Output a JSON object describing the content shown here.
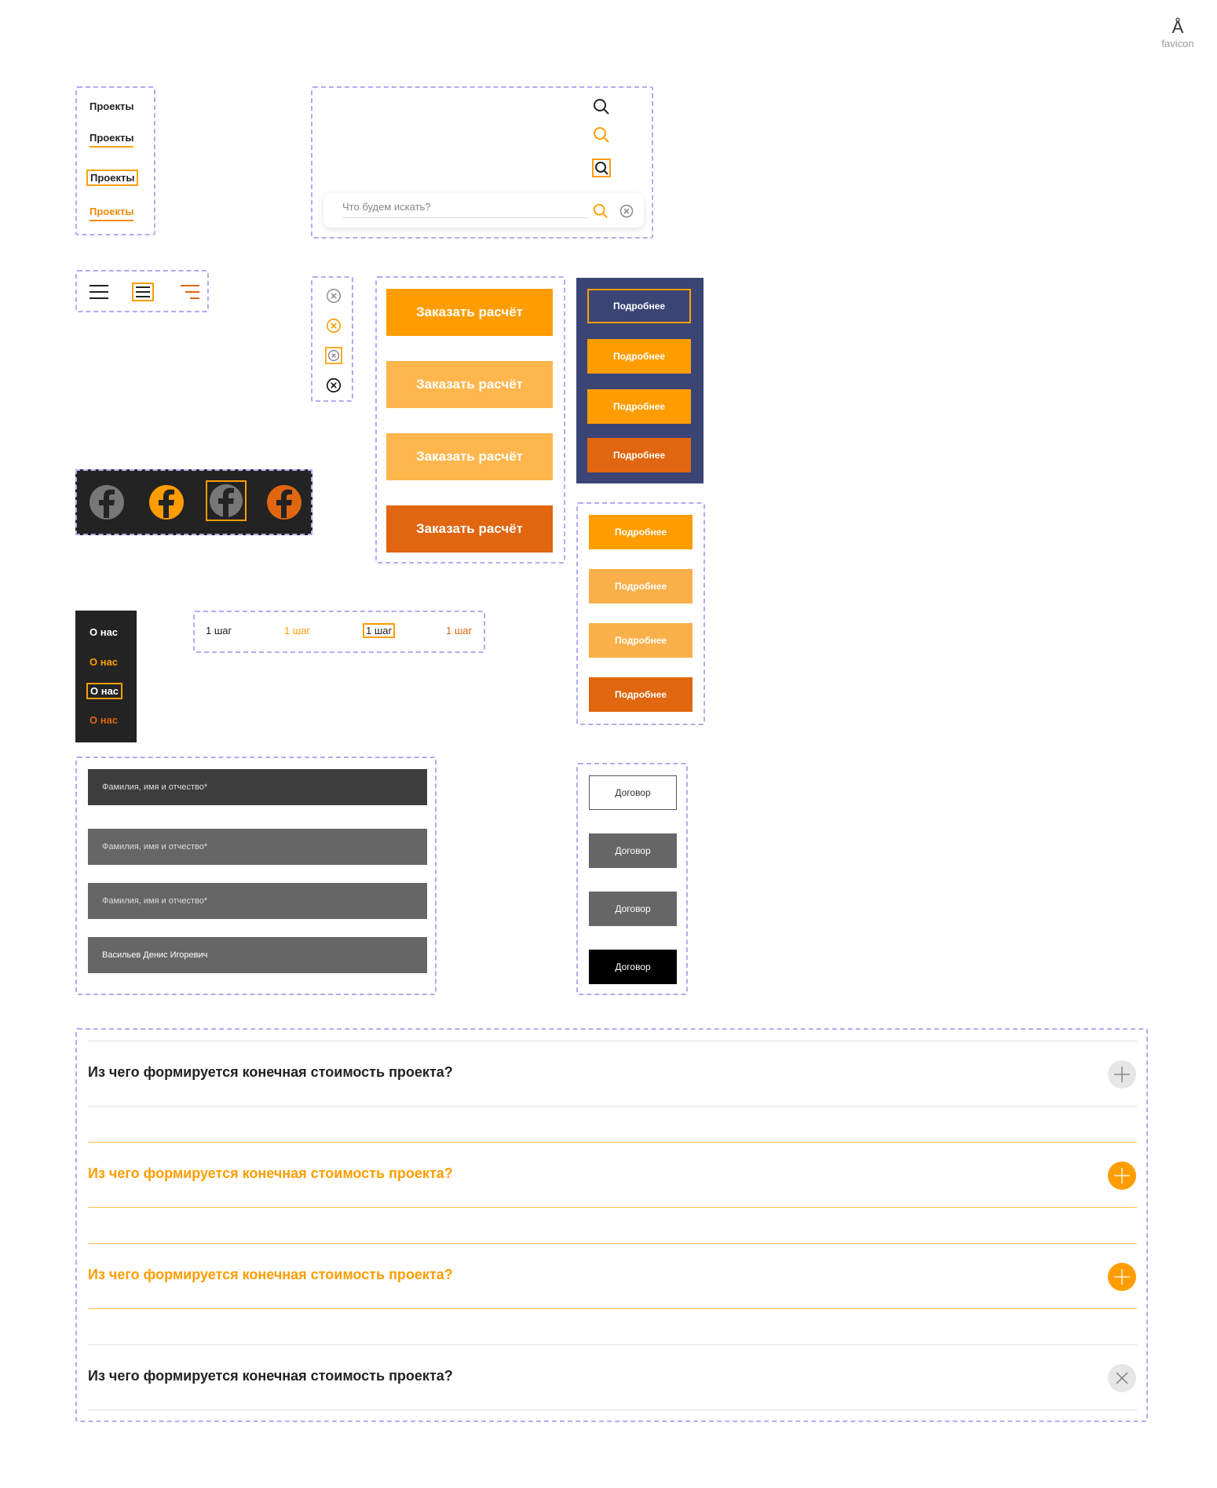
{
  "favicon": {
    "glyph": "Å",
    "label": "favicon"
  },
  "nav": {
    "items": [
      "Проекты",
      "Проекты",
      "Проекты",
      "Проекты"
    ]
  },
  "search": {
    "placeholder": "Что будем искать?"
  },
  "order_buttons": [
    "Заказать расчёт",
    "Заказать расчёт",
    "Заказать расчёт",
    "Заказать расчёт"
  ],
  "details_buttons_dark": [
    "Подробнее",
    "Подробнее",
    "Подробнее",
    "Подробнее"
  ],
  "details_buttons_light": [
    "Подробнее",
    "Подробнее",
    "Подробнее",
    "Подробнее"
  ],
  "about": [
    "О нас",
    "О нас",
    "О нас",
    "О нас"
  ],
  "steps": [
    "1 шаг",
    "1 шаг",
    "1 шаг",
    "1 шаг"
  ],
  "inputs": [
    "Фамилия, имя и отчество*",
    "Фамилия, имя и отчество*",
    "Фамилия, имя и отчество*",
    "Васильев Денис Игоревич"
  ],
  "contracts": [
    "Договор",
    "Договор",
    "Договор",
    "Договор"
  ],
  "faq": [
    "Из чего формируется конечная стоимость проекта?",
    "Из чего формируется конечная стоимость проекта?",
    "Из чего формируется конечная стоимость проекта?",
    "Из чего формируется конечная стоимость проекта?"
  ],
  "colors": {
    "orange": "#ff9d00",
    "orange_light": "#ffb64d",
    "orange_dark": "#e0660f",
    "navy": "#3b4575",
    "dark": "#232323",
    "guide": "#b6a9f0"
  }
}
